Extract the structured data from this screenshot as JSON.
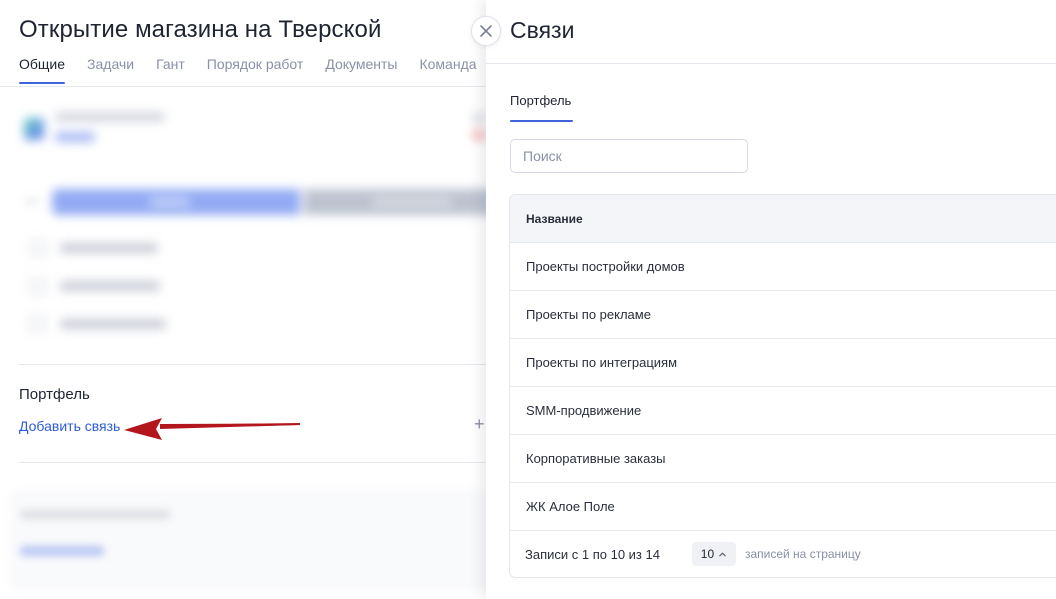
{
  "project": {
    "title": "Открытие магазина на Тверской",
    "tabs": [
      {
        "label": "Общие",
        "active": true
      },
      {
        "label": "Задачи"
      },
      {
        "label": "Гант"
      },
      {
        "label": "Порядок работ"
      },
      {
        "label": "Документы"
      },
      {
        "label": "Команда"
      }
    ],
    "portfolio_title": "Портфель",
    "add_link_label": "Добавить связь",
    "plus_icon": "+"
  },
  "panel": {
    "title": "Связи",
    "tab_label": "Портфель",
    "search_placeholder": "Поиск",
    "search_value": "",
    "table": {
      "column_header": "Название",
      "rows": [
        "Проекты постройки домов",
        "Проекты по рекламе",
        "Проекты по интеграциям",
        "SMM-продвижение",
        "Корпоративные заказы",
        "ЖК Алое Поле"
      ]
    },
    "pagination": {
      "records_label": "Записи с 1 по 10 из 14",
      "page_size": "10",
      "per_page_label": "записей на страницу"
    }
  },
  "colors": {
    "accent": "#3e63dd",
    "link": "#2f5bd8",
    "annotation_arrow": "#b3161c"
  }
}
